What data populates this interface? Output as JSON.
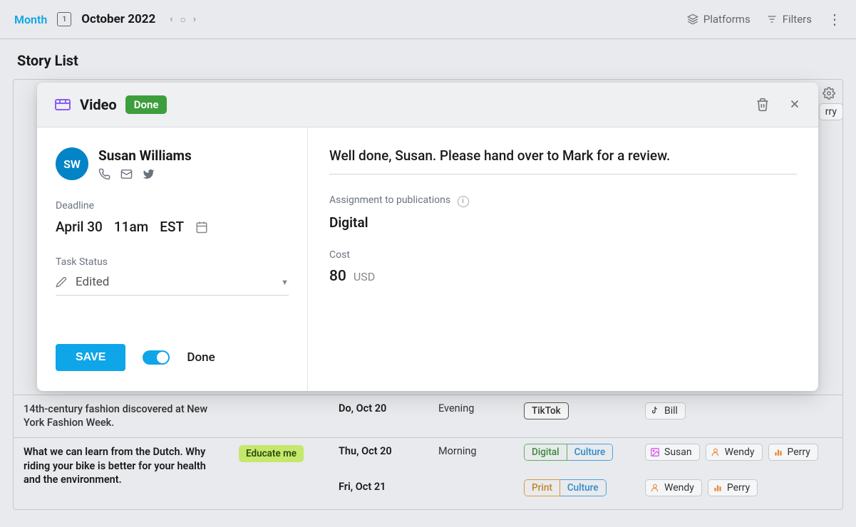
{
  "topbar": {
    "view_label": "Month",
    "date_box": "1",
    "current": "October 2022",
    "platforms_label": "Platforms",
    "filters_label": "Filters"
  },
  "page": {
    "title": "Story List"
  },
  "partial_chip": "rry",
  "stories": [
    {
      "title_fragment": "14th-century fashion discovered at New York Fashion Week.",
      "rows": [
        {
          "date": "Do, Oct 20",
          "time": "Evening",
          "cats": [
            {
              "text": "TikTok",
              "cls": "cat-tiktok"
            }
          ],
          "people": [
            {
              "name": "Bill",
              "icon": "tiktok"
            }
          ]
        }
      ]
    },
    {
      "title": "What we can learn from the Dutch. Why riding your bike is better for your health and the environment.",
      "tag": "Educate me",
      "rows": [
        {
          "date": "Thu, Oct 20",
          "time": "Morning",
          "cats": [
            {
              "text": "Digital",
              "cls": "cat-digital"
            },
            {
              "text": "Culture",
              "cls": "cat-culture"
            }
          ],
          "people": [
            {
              "name": "Susan",
              "icon": "pink"
            },
            {
              "name": "Wendy",
              "icon": "person"
            },
            {
              "name": "Perry",
              "icon": "bars"
            }
          ]
        },
        {
          "date": "Fri, Oct 21",
          "time": "",
          "cats": [
            {
              "text": "Print",
              "cls": "cat-print"
            },
            {
              "text": "Culture",
              "cls": "cat-culture"
            }
          ],
          "people": [
            {
              "name": "Wendy",
              "icon": "person"
            },
            {
              "name": "Perry",
              "icon": "bars"
            }
          ]
        }
      ]
    }
  ],
  "modal": {
    "type_label": "Video",
    "status_badge": "Done",
    "person": {
      "initials": "SW",
      "name": "Susan Williams"
    },
    "deadline_label": "Deadline",
    "deadline": {
      "date": "April 30",
      "time": "11am",
      "tz": "EST"
    },
    "task_status_label": "Task Status",
    "task_status_value": "Edited",
    "save_label": "SAVE",
    "toggle_label": "Done",
    "comment": "Well done, Susan. Please hand over to Mark for a review.",
    "assignment_label": "Assignment to publications",
    "assignment_value": "Digital",
    "cost_label": "Cost",
    "cost_value": "80",
    "cost_currency": "USD"
  }
}
